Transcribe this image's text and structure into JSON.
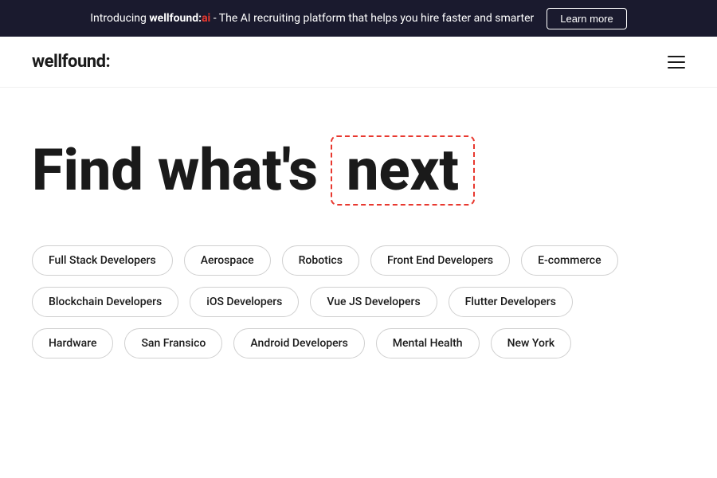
{
  "banner": {
    "text_before_brand": "Introducing ",
    "brand": "wellfound:",
    "ai": "ai",
    "text_after": " - The AI recruiting platform that helps you hire faster and smarter",
    "learn_more_label": "Learn more"
  },
  "header": {
    "logo": "wellfound:",
    "hamburger_label": "menu"
  },
  "hero": {
    "headline_static": "Find what's",
    "headline_highlight": "next"
  },
  "tags": {
    "row1": [
      "Full Stack Developers",
      "Aerospace",
      "Robotics",
      "Front End Developers",
      "E-commerce"
    ],
    "row2": [
      "Blockchain Developers",
      "iOS Developers",
      "Vue JS Developers",
      "Flutter Developers"
    ],
    "row3": [
      "Hardware",
      "San Fransico",
      "Android Developers",
      "Mental Health",
      "New York"
    ]
  }
}
